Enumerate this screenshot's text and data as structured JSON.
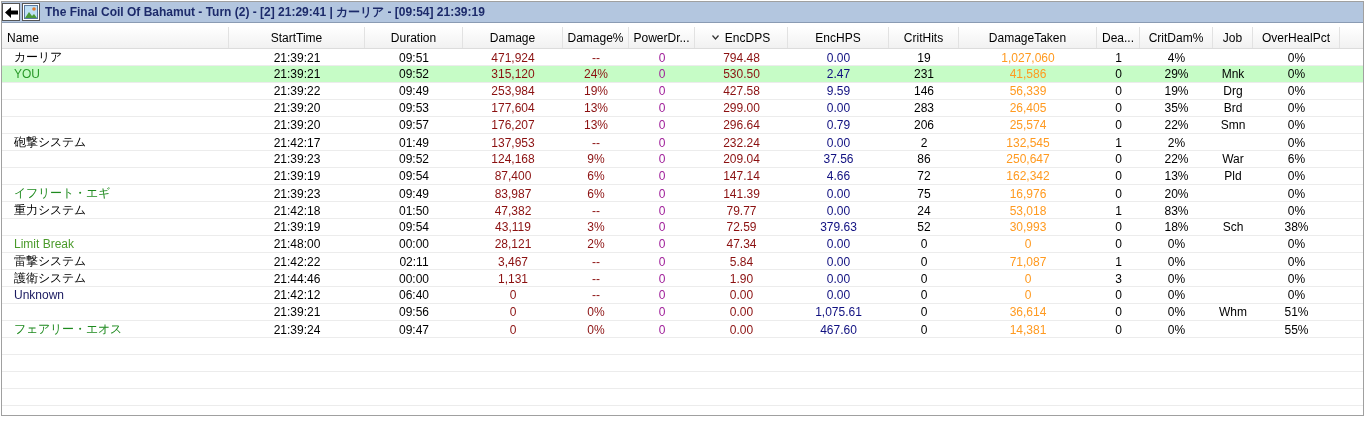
{
  "window": {
    "title": "The Final Coil Of Bahamut - Turn (2) - [2] 21:29:41 | カーリア - [09:54] 21:39:19"
  },
  "table": {
    "columns": [
      {
        "label": "Name"
      },
      {
        "label": "StartTime"
      },
      {
        "label": "Duration"
      },
      {
        "label": "Damage"
      },
      {
        "label": "Damage%"
      },
      {
        "label": "PowerDr..."
      },
      {
        "label": "EncDPS",
        "sorted": true
      },
      {
        "label": "EncHPS"
      },
      {
        "label": "CritHits"
      },
      {
        "label": "DamageTaken"
      },
      {
        "label": "Dea..."
      },
      {
        "label": "CritDam%"
      },
      {
        "label": "Job"
      },
      {
        "label": "OverHealPct"
      }
    ],
    "rows": [
      {
        "selected": false,
        "cells": [
          "カーリア",
          "21:39:21",
          "09:51",
          "471,924",
          "--",
          "0",
          "794.48",
          "0.00",
          "19",
          "1,027,060",
          "1",
          "4%",
          "",
          "0%"
        ]
      },
      {
        "selected": true,
        "color": "#2a9a2a",
        "cells": [
          "YOU",
          "21:39:21",
          "09:52",
          "315,120",
          "24%",
          "0",
          "530.50",
          "2.47",
          "231",
          "41,586",
          "0",
          "29%",
          "Mnk",
          "0%"
        ]
      },
      {
        "selected": false,
        "cells": [
          "",
          "21:39:22",
          "09:49",
          "253,984",
          "19%",
          "0",
          "427.58",
          "9.59",
          "146",
          "56,339",
          "0",
          "19%",
          "Drg",
          "0%"
        ]
      },
      {
        "selected": false,
        "cells": [
          "",
          "21:39:20",
          "09:53",
          "177,604",
          "13%",
          "0",
          "299.00",
          "0.00",
          "283",
          "26,405",
          "0",
          "35%",
          "Brd",
          "0%"
        ]
      },
      {
        "selected": false,
        "cells": [
          "",
          "21:39:20",
          "09:57",
          "176,207",
          "13%",
          "0",
          "296.64",
          "0.79",
          "206",
          "25,574",
          "0",
          "22%",
          "Smn",
          "0%"
        ]
      },
      {
        "selected": false,
        "cells": [
          "砲撃システム",
          "21:42:17",
          "01:49",
          "137,953",
          "--",
          "0",
          "232.24",
          "0.00",
          "2",
          "132,545",
          "1",
          "2%",
          "",
          "0%"
        ]
      },
      {
        "selected": false,
        "cells": [
          "",
          "21:39:23",
          "09:52",
          "124,168",
          "9%",
          "0",
          "209.04",
          "37.56",
          "86",
          "250,647",
          "0",
          "22%",
          "War",
          "6%"
        ]
      },
      {
        "selected": false,
        "cells": [
          "",
          "21:39:19",
          "09:54",
          "87,400",
          "6%",
          "0",
          "147.14",
          "4.66",
          "72",
          "162,342",
          "0",
          "13%",
          "Pld",
          "0%"
        ]
      },
      {
        "selected": false,
        "color": "#1e8a1e",
        "cells": [
          "イフリート・エギ",
          "21:39:23",
          "09:49",
          "83,987",
          "6%",
          "0",
          "141.39",
          "0.00",
          "75",
          "16,976",
          "0",
          "20%",
          "",
          "0%"
        ]
      },
      {
        "selected": false,
        "cells": [
          "重力システム",
          "21:42:18",
          "01:50",
          "47,382",
          "--",
          "0",
          "79.77",
          "0.00",
          "24",
          "53,018",
          "1",
          "83%",
          "",
          "0%"
        ]
      },
      {
        "selected": false,
        "cells": [
          "",
          "21:39:19",
          "09:54",
          "43,119",
          "3%",
          "0",
          "72.59",
          "379.63",
          "52",
          "30,993",
          "0",
          "18%",
          "Sch",
          "38%"
        ]
      },
      {
        "selected": false,
        "color": "#4a9a2a",
        "cells": [
          "Limit Break",
          "21:48:00",
          "00:00",
          "28,121",
          "2%",
          "0",
          "47.34",
          "0.00",
          "0",
          "0",
          "0",
          "0%",
          "",
          "0%"
        ]
      },
      {
        "selected": false,
        "cells": [
          "雷撃システム",
          "21:42:22",
          "02:11",
          "3,467",
          "--",
          "0",
          "5.84",
          "0.00",
          "0",
          "71,087",
          "1",
          "0%",
          "",
          "0%"
        ]
      },
      {
        "selected": false,
        "cells": [
          "護衛システム",
          "21:44:46",
          "00:00",
          "1,131",
          "--",
          "0",
          "1.90",
          "0.00",
          "0",
          "0",
          "3",
          "0%",
          "",
          "0%"
        ]
      },
      {
        "selected": false,
        "color": "#1a1a60",
        "cells": [
          "Unknown",
          "21:42:12",
          "06:40",
          "0",
          "--",
          "0",
          "0.00",
          "0.00",
          "0",
          "0",
          "0",
          "0%",
          "",
          "0%"
        ]
      },
      {
        "selected": false,
        "cells": [
          "",
          "21:39:21",
          "09:56",
          "0",
          "0%",
          "0",
          "0.00",
          "1,075.61",
          "0",
          "36,614",
          "0",
          "0%",
          "Whm",
          "51%"
        ]
      },
      {
        "selected": false,
        "color": "#1e8a1e",
        "cells": [
          "フェアリー・エオス",
          "21:39:24",
          "09:47",
          "0",
          "0%",
          "0",
          "0.00",
          "467.60",
          "0",
          "14,381",
          "0",
          "0%",
          "",
          "55%"
        ]
      }
    ]
  }
}
